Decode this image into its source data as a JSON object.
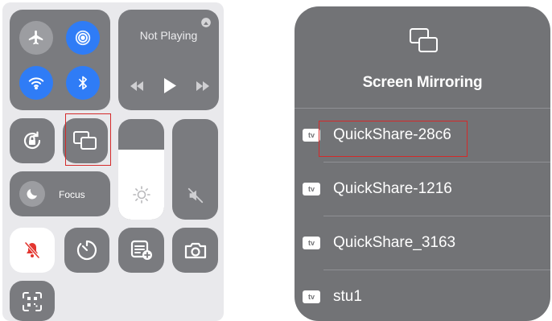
{
  "colors": {
    "tile": "#7a7b7f",
    "active_blue": "#2f7cf6",
    "highlight_red": "#d42a2a",
    "panel": "#727376"
  },
  "control_center": {
    "connectivity": {
      "airplane_icon": "airplane-icon",
      "airdrop_icon": "airdrop-icon",
      "wifi_icon": "wifi-icon",
      "bluetooth_icon": "bluetooth-icon"
    },
    "now_playing": {
      "title": "Not Playing",
      "airplay_icon": "airplay-icon",
      "rewind_icon": "rewind-icon",
      "play_icon": "play-icon",
      "forward_icon": "fast-forward-icon"
    },
    "rotation_lock_icon": "rotation-lock-icon",
    "screen_mirroring_icon": "screen-mirroring-icon",
    "focus": {
      "label": "Focus",
      "icon": "moon-icon"
    },
    "brightness_icon": "sun-icon",
    "volume_icon": "speaker-muted-icon",
    "silent_icon": "bell-slash-icon",
    "timer_icon": "timer-icon",
    "notes_icon": "quick-note-icon",
    "camera_icon": "camera-icon",
    "code_scanner_icon": "qr-scanner-icon"
  },
  "screen_mirroring": {
    "title": "Screen Mirroring",
    "header_icon": "screen-mirroring-icon",
    "devices": [
      {
        "badge": "tv",
        "name": "QuickShare-28c6"
      },
      {
        "badge": "tv",
        "name": "QuickShare-1216"
      },
      {
        "badge": "tv",
        "name": "QuickShare_3163"
      },
      {
        "badge": "tv",
        "name": "stu1"
      }
    ]
  }
}
